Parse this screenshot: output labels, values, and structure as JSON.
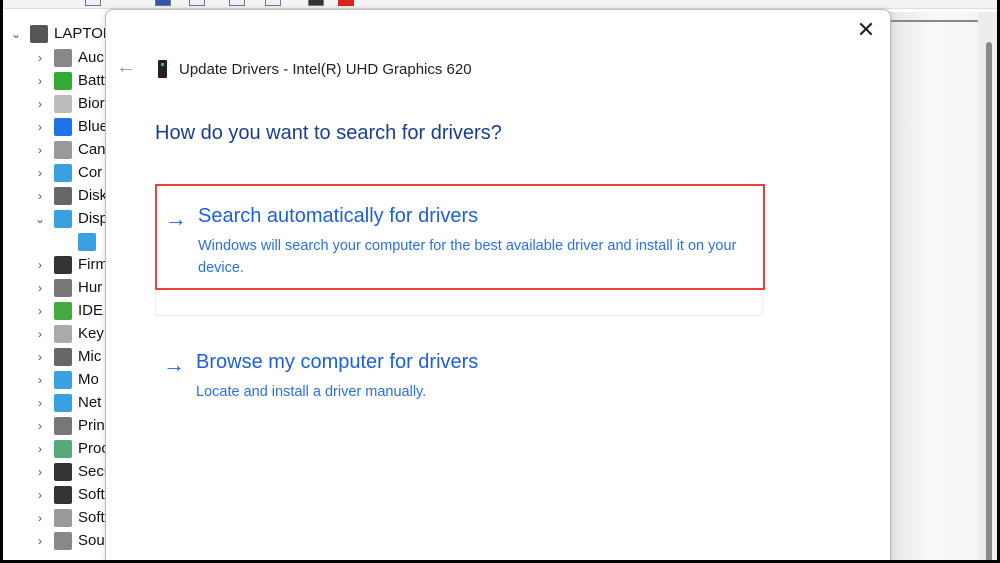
{
  "tree": {
    "root": "LAPTOP",
    "items": [
      {
        "label": "Auc",
        "color": "#888"
      },
      {
        "label": "Batt",
        "color": "#3a3"
      },
      {
        "label": "Bior",
        "color": "#bbb"
      },
      {
        "label": "Blue",
        "color": "#1e73e8"
      },
      {
        "label": "Can",
        "color": "#999"
      },
      {
        "label": "Cor",
        "color": "#3aa0e0"
      },
      {
        "label": "Disk",
        "color": "#666"
      },
      {
        "label": "Disp",
        "color": "#3aa0e0",
        "expanded": true
      },
      {
        "label": "",
        "color": "#3aa0e0",
        "child": true
      },
      {
        "label": "Firm",
        "color": "#333"
      },
      {
        "label": "Hur",
        "color": "#777"
      },
      {
        "label": "IDE",
        "color": "#4a4"
      },
      {
        "label": "Key",
        "color": "#aaa"
      },
      {
        "label": "Mic",
        "color": "#666"
      },
      {
        "label": "Mo",
        "color": "#3aa0e0"
      },
      {
        "label": "Net",
        "color": "#3aa0e0"
      },
      {
        "label": "Prin",
        "color": "#777"
      },
      {
        "label": "Proc",
        "color": "#5a7"
      },
      {
        "label": "Secu",
        "color": "#333"
      },
      {
        "label": "Soft",
        "color": "#333"
      },
      {
        "label": "Soft",
        "color": "#999"
      },
      {
        "label": "Sou",
        "color": "#888"
      }
    ]
  },
  "dialog": {
    "title": "Update Drivers - Intel(R) UHD Graphics 620",
    "heading": "How do you want to search for drivers?",
    "options": [
      {
        "title": "Search automatically for drivers",
        "desc": "Windows will search your computer for the best available driver and install it on your device."
      },
      {
        "title": "Browse my computer for drivers",
        "desc": "Locate and install a driver manually."
      }
    ],
    "arrow": "→",
    "back": "←",
    "close": "✕"
  },
  "colors": {
    "accent": "#1f5fd6",
    "highlight": "#e8403a"
  }
}
